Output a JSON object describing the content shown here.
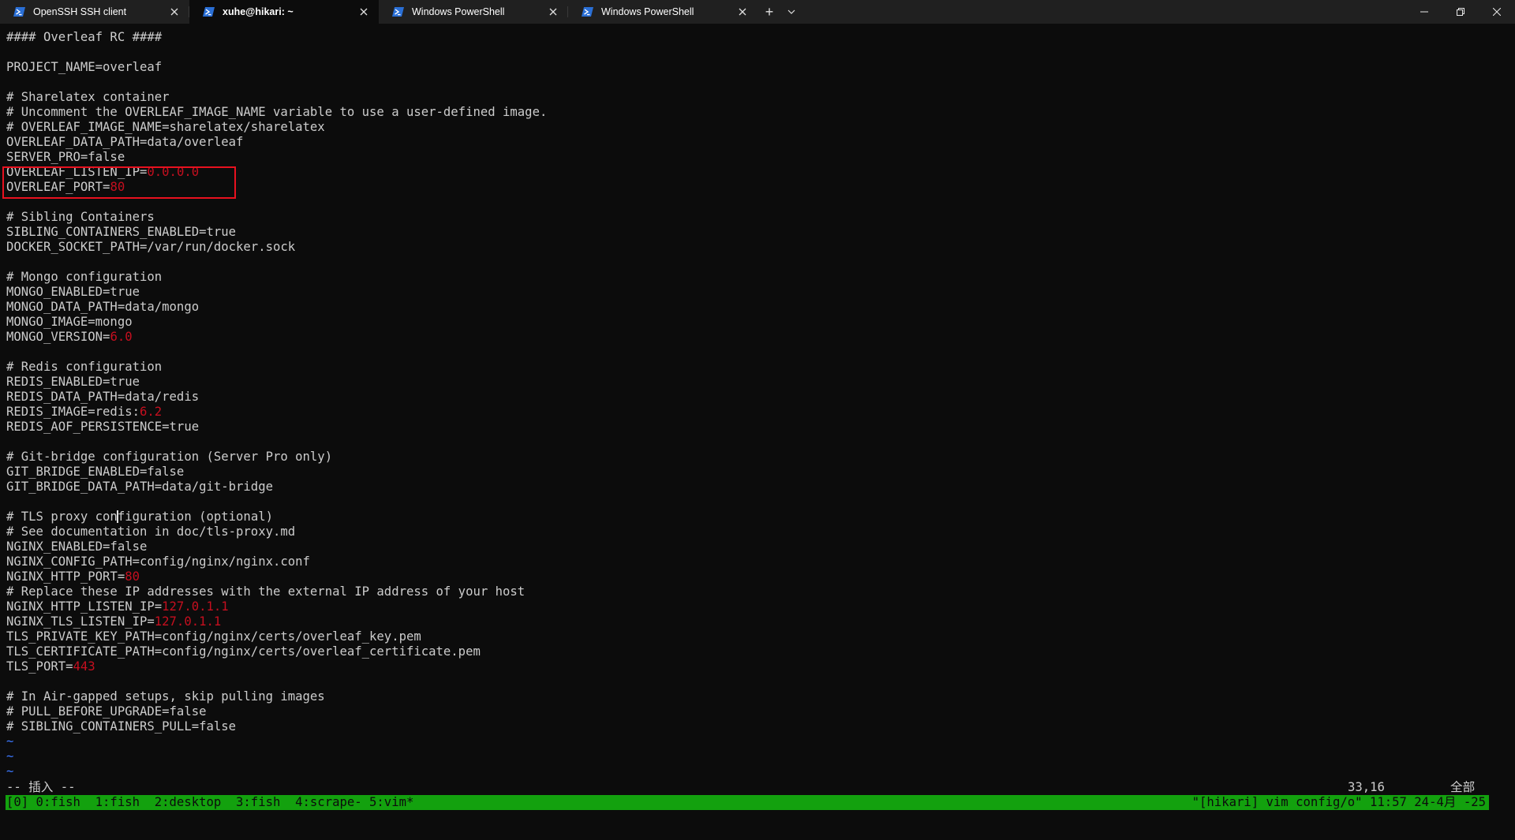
{
  "tabs": [
    {
      "title": "OpenSSH SSH client",
      "icon": "powershell-icon",
      "active": false
    },
    {
      "title": "xuhe@hikari: ~",
      "icon": "powershell-icon",
      "active": true
    },
    {
      "title": "Windows PowerShell",
      "icon": "powershell-icon",
      "active": false
    },
    {
      "title": "Windows PowerShell",
      "icon": "powershell-icon",
      "active": false
    }
  ],
  "tab_actions": {
    "new_tab": "+",
    "dropdown": "⌄"
  },
  "window_controls": {
    "minimize": "─",
    "restore": "❐",
    "close": "✕"
  },
  "colors": {
    "terminal_bg": "#0c0c0c",
    "text": "#cccccc",
    "red": "#c50f1f",
    "tmux_green": "#13a10e",
    "highlight_box": "#e8111f"
  },
  "file_lines": [
    [
      "#### Overleaf RC ####"
    ],
    [
      ""
    ],
    [
      "PROJECT_NAME=overleaf"
    ],
    [
      ""
    ],
    [
      "# Sharelatex container"
    ],
    [
      "# Uncomment the OVERLEAF_IMAGE_NAME variable to use a user-defined image."
    ],
    [
      "# OVERLEAF_IMAGE_NAME=sharelatex/sharelatex"
    ],
    [
      "OVERLEAF_DATA_PATH=data/overleaf"
    ],
    [
      "SERVER_PRO=false"
    ],
    [
      "OVERLEAF_LISTEN_IP=",
      "0.0.0.0"
    ],
    [
      "OVERLEAF_PORT=",
      "80"
    ],
    [
      ""
    ],
    [
      "# Sibling Containers"
    ],
    [
      "SIBLING_CONTAINERS_ENABLED=true"
    ],
    [
      "DOCKER_SOCKET_PATH=/var/run/docker.sock"
    ],
    [
      ""
    ],
    [
      "# Mongo configuration"
    ],
    [
      "MONGO_ENABLED=true"
    ],
    [
      "MONGO_DATA_PATH=data/mongo"
    ],
    [
      "MONGO_IMAGE=mongo"
    ],
    [
      "MONGO_VERSION=",
      "6.0"
    ],
    [
      ""
    ],
    [
      "# Redis configuration"
    ],
    [
      "REDIS_ENABLED=true"
    ],
    [
      "REDIS_DATA_PATH=data/redis"
    ],
    [
      "REDIS_IMAGE=redis:",
      "6.2"
    ],
    [
      "REDIS_AOF_PERSISTENCE=true"
    ],
    [
      ""
    ],
    [
      "# Git-bridge configuration (Server Pro only)"
    ],
    [
      "GIT_BRIDGE_ENABLED=false"
    ],
    [
      "GIT_BRIDGE_DATA_PATH=data/git-bridge"
    ],
    [
      ""
    ],
    [
      "# TLS proxy con|figuration (optional)"
    ],
    [
      "# See documentation in doc/tls-proxy.md"
    ],
    [
      "NGINX_ENABLED=false"
    ],
    [
      "NGINX_CONFIG_PATH=config/nginx/nginx.conf"
    ],
    [
      "NGINX_HTTP_PORT=",
      "80"
    ],
    [
      "# Replace these IP addresses with the external IP address of your host"
    ],
    [
      "NGINX_HTTP_LISTEN_IP=",
      "127.0.1.1"
    ],
    [
      "NGINX_TLS_LISTEN_IP=",
      "127.0.1.1"
    ],
    [
      "TLS_PRIVATE_KEY_PATH=config/nginx/certs/overleaf_key.pem"
    ],
    [
      "TLS_CERTIFICATE_PATH=config/nginx/certs/overleaf_certificate.pem"
    ],
    [
      "TLS_PORT=",
      "443"
    ],
    [
      ""
    ],
    [
      "# In Air-gapped setups, skip pulling images"
    ],
    [
      "# PULL_BEFORE_UPGRADE=false"
    ],
    [
      "# SIBLING_CONTAINERS_PULL=false"
    ]
  ],
  "tilde_lines": [
    "~",
    "~",
    "~"
  ],
  "vim": {
    "mode": "-- 插入 --",
    "cursor_position": "33,16",
    "scroll": "全部"
  },
  "tmux": {
    "left": "[0] 0:fish  1:fish  2:desktop  3:fish  4:scrape- 5:vim*",
    "right": "\"[hikari] vim config/o\" 11:57 24-4月 -25"
  }
}
